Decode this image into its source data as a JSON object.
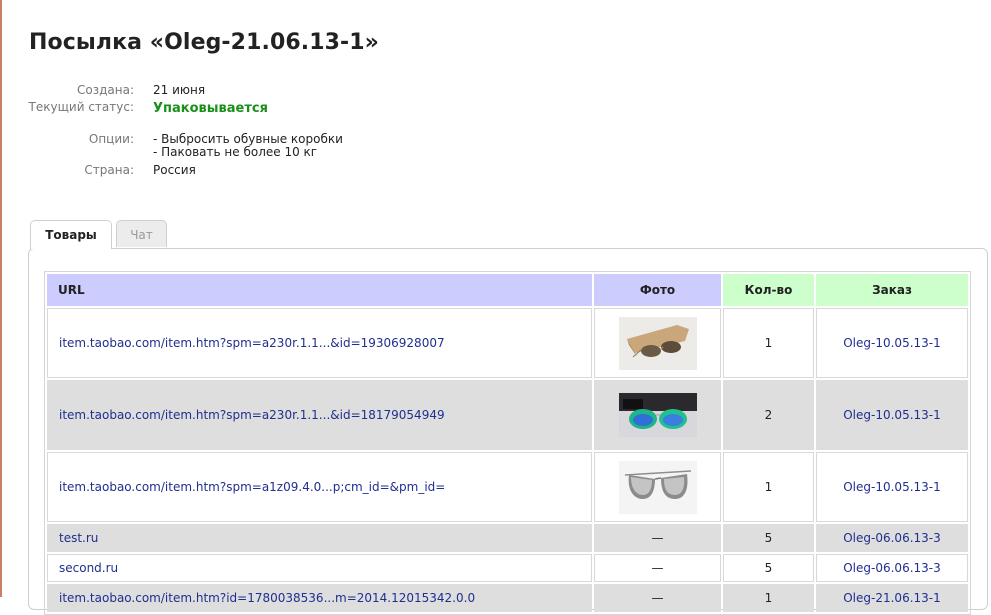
{
  "title": "Посылка «Oleg-21.06.13-1»",
  "info": {
    "created_label": "Создана:",
    "created_value": "21 июня",
    "status_label": "Текущий статус:",
    "status_value": "Упаковывается",
    "options_label": "Опции:",
    "options": [
      "- Выбросить обувные коробки",
      "- Паковать не более 10 кг"
    ],
    "country_label": "Страна:",
    "country_value": "Россия"
  },
  "tabs": [
    {
      "label": "Товары",
      "active": true
    },
    {
      "label": "Чат",
      "active": false
    }
  ],
  "table": {
    "headers": {
      "url": "URL",
      "photo": "Фото",
      "qty": "Кол-во",
      "order": "Заказ"
    },
    "rows": [
      {
        "url": "item.taobao.com/item.htm?spm=a230r.1.1...&id=19306928007",
        "photo": "sunglasses-with-case-photo",
        "qty": "1",
        "order": "Oleg-10.05.13-1"
      },
      {
        "url": "item.taobao.com/item.htm?spm=a230r.1.1...&id=18179054949",
        "photo": "mirrored-aviator-photo",
        "qty": "2",
        "order": "Oleg-10.05.13-1"
      },
      {
        "url": "item.taobao.com/item.htm?spm=a1z09.4.0...p;cm_id=&pm_id=",
        "photo": "silver-aviator-photo",
        "qty": "1",
        "order": "Oleg-10.05.13-1"
      },
      {
        "url": "test.ru",
        "photo": "—",
        "qty": "5",
        "order": "Oleg-06.06.13-3"
      },
      {
        "url": "second.ru",
        "photo": "—",
        "qty": "5",
        "order": "Oleg-06.06.13-3"
      },
      {
        "url": "item.taobao.com/item.htm?id=1780038536...m=2014.12015342.0.0",
        "photo": "—",
        "qty": "1",
        "order": "Oleg-21.06.13-1"
      }
    ]
  }
}
